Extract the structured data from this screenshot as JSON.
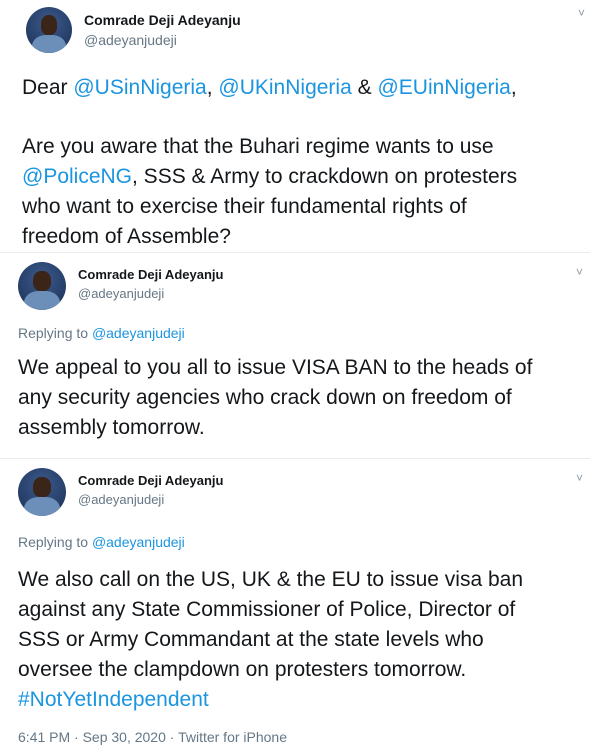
{
  "tweet1": {
    "name": "Comrade Deji Adeyanju",
    "handle": "@adeyanjudeji",
    "chevron": "˅",
    "line1": {
      "prefix": "Dear ",
      "m1": "@USinNigeria",
      "sep1": ", ",
      "m2": "@UKinNigeria",
      "sep2": " & ",
      "m3": "@EUinNigeria",
      "suffix": ","
    },
    "line2": "Are you aware that the Buhari regime wants to use",
    "line3": {
      "mention": "@PoliceNG",
      "rest": ", SSS & Army to crackdown on protesters"
    },
    "line4": "who want to exercise their fundamental rights of",
    "line5": "freedom of Assemble?"
  },
  "tweet2": {
    "name": "Comrade Deji Adeyanju",
    "handle": "@adeyanjudeji",
    "chevron": "˅",
    "replying_prefix": "Replying to ",
    "replying_to": "@adeyanjudeji",
    "line1": "We appeal to you all to issue VISA BAN to the heads of",
    "line2": "any security agencies who crack down on freedom of",
    "line3": "assembly tomorrow."
  },
  "tweet3": {
    "name": "Comrade Deji Adeyanju",
    "handle": "@adeyanjudeji",
    "chevron": "˅",
    "replying_prefix": "Replying to ",
    "replying_to": "@adeyanjudeji",
    "line1": "We also call on the US, UK & the EU to issue visa ban",
    "line2": "against any State Commissioner of Police, Director of",
    "line3": "SSS or Army Commandant at the state levels who",
    "line4": "oversee the clampdown on protesters tomorrow.",
    "hashtag": "#NotYetIndependent",
    "timestamp": "6:41 PM · Sep 30, 2020 · Twitter for iPhone"
  },
  "colors": {
    "link": "#1b95e0",
    "text": "#14171a",
    "muted": "#657786"
  }
}
